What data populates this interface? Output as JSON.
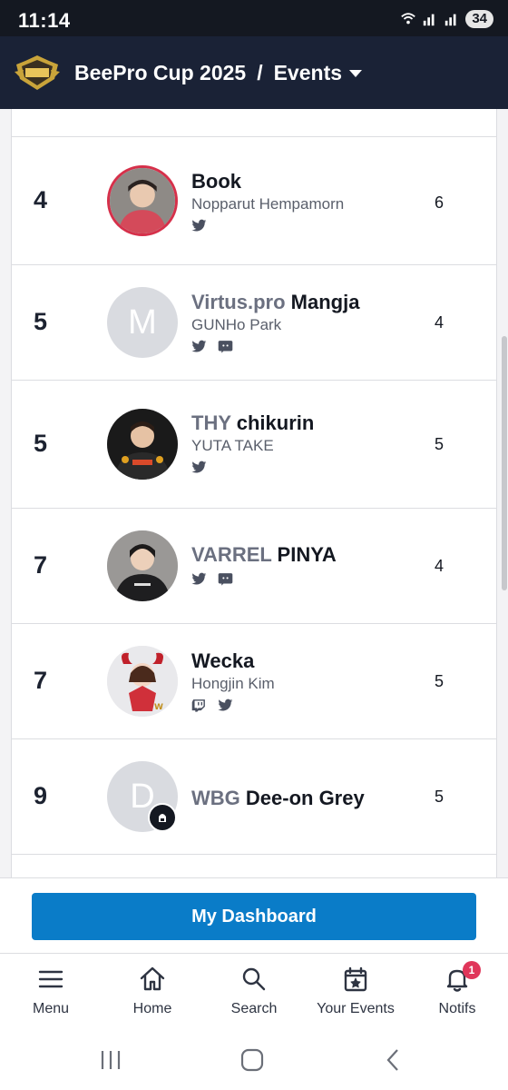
{
  "status": {
    "time": "11:14",
    "battery": "34"
  },
  "header": {
    "title": "BeePro Cup 2025",
    "separator": "/",
    "section": "Events"
  },
  "rows": [
    {
      "rank": "4",
      "team": "",
      "name": "Book",
      "real_name": "Nopparut Hempamorn",
      "socials": [
        "twitter-icon"
      ],
      "count": "6",
      "avatar": "photo"
    },
    {
      "rank": "5",
      "team": "Virtus.pro",
      "name": "Mangja",
      "real_name": "GUNHo Park",
      "socials": [
        "twitter-icon",
        "discord-icon"
      ],
      "count": "4",
      "avatar": "M"
    },
    {
      "rank": "5",
      "team": "THY",
      "name": "chikurin",
      "real_name": "YUTA TAKE",
      "socials": [
        "twitter-icon"
      ],
      "count": "5",
      "avatar": "photo"
    },
    {
      "rank": "7",
      "team": "VARREL",
      "name": "PINYA",
      "real_name": "",
      "socials": [
        "twitter-icon",
        "discord-icon"
      ],
      "count": "4",
      "avatar": "photo"
    },
    {
      "rank": "7",
      "team": "",
      "name": "Wecka",
      "real_name": "Hongjin Kim",
      "socials": [
        "twitch-icon",
        "twitter-icon"
      ],
      "count": "5",
      "avatar": "illustration"
    },
    {
      "rank": "9",
      "team": "WBG",
      "name": "Dee-on Grey",
      "real_name": "",
      "socials": [],
      "count": "5",
      "avatar": "D"
    }
  ],
  "dashboard": {
    "label": "My Dashboard"
  },
  "nav": [
    {
      "label": "Menu",
      "icon": "menu-icon"
    },
    {
      "label": "Home",
      "icon": "home-icon"
    },
    {
      "label": "Search",
      "icon": "search-icon"
    },
    {
      "label": "Your Events",
      "icon": "calendar-star-icon"
    },
    {
      "label": "Notifs",
      "icon": "bell-icon",
      "badge": "1"
    }
  ],
  "colors": {
    "header_bg": "#1a2236",
    "accent": "#0a7cc8",
    "notif": "#e0365a"
  }
}
